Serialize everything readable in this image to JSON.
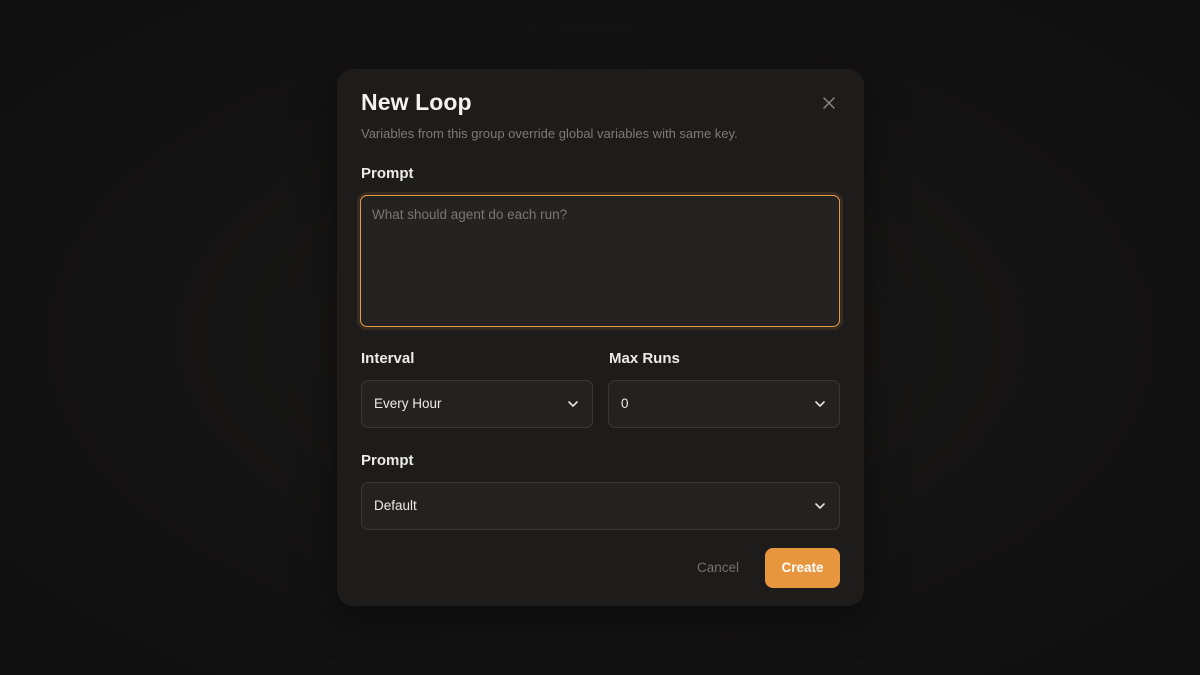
{
  "dialog": {
    "title": "New Loop",
    "subtitle": "Variables from this group override global variables with same key.",
    "close_icon": "close-icon"
  },
  "prompt_field": {
    "label": "Prompt",
    "placeholder": "What should agent do each run?",
    "value": ""
  },
  "interval": {
    "label": "Interval",
    "value": "Every Hour",
    "icon": "chevron-down-icon"
  },
  "max_runs": {
    "label": "Max Runs",
    "value": "0",
    "icon": "chevron-down-icon"
  },
  "prompt_select": {
    "label": "Prompt",
    "value": "Default",
    "icon": "chevron-down-icon"
  },
  "actions": {
    "cancel_label": "Cancel",
    "create_label": "Create"
  },
  "colors": {
    "accent": "#e8963e",
    "background": "#121111",
    "dialog": "#1d1c1b"
  }
}
